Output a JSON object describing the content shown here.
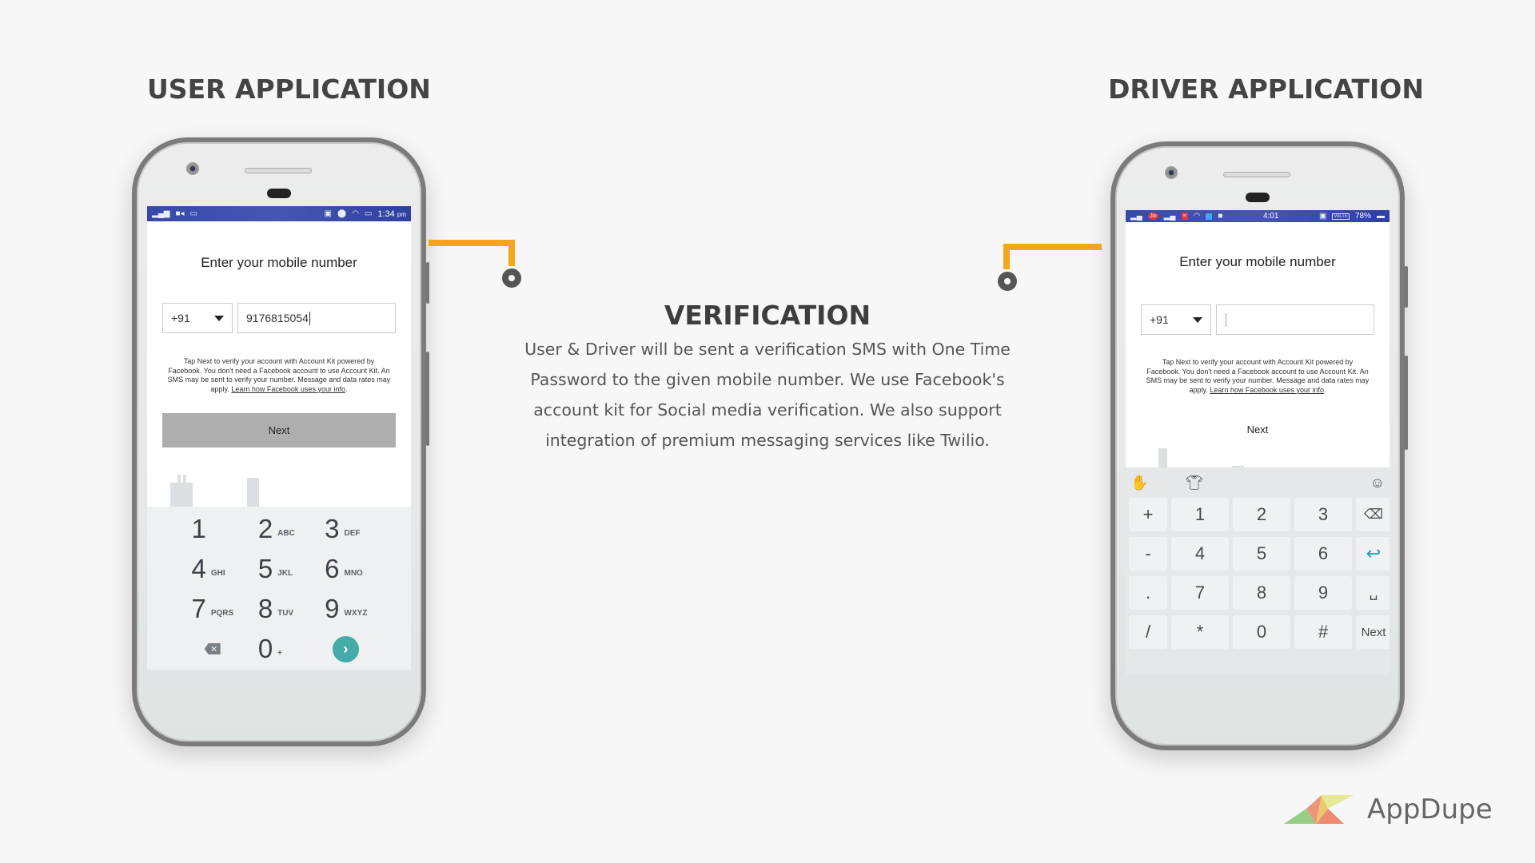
{
  "headings": {
    "user": "USER APPLICATION",
    "driver": "DRIVER APPLICATION"
  },
  "verification": {
    "title": "VERIFICATION",
    "body": "User & Driver will be sent a verification SMS with One Time Password to the given mobile number. We use Facebook's account kit for Social media verification. We also support integration of premium messaging services like Twilio."
  },
  "colors": {
    "connector": "#f2a816",
    "status_bar": "#3848a8",
    "go_button": "#45aaa8",
    "background": "#f7f7f7"
  },
  "user_app": {
    "status_bar": {
      "left_icons": [
        "signal-icon",
        "video-icon",
        "keyboard-icon"
      ],
      "right_icons": [
        "cast-icon",
        "location-icon",
        "wifi-icon",
        "battery-icon"
      ],
      "time": "1:34",
      "ampm": "pm"
    },
    "title": "Enter your mobile number",
    "country_code": "+91",
    "phone_value": "9176815054",
    "disclaimer": "Tap Next to verify your account with Account Kit powered by Facebook. You don't need a Facebook account to use Account Kit. An SMS may be sent to verify your number. Message and data rates may apply. ",
    "disclaimer_link": "Learn how Facebook uses your info",
    "next_label": "Next",
    "dialpad": [
      {
        "num": "1",
        "letters": ""
      },
      {
        "num": "2",
        "letters": "ABC"
      },
      {
        "num": "3",
        "letters": "DEF"
      },
      {
        "num": "4",
        "letters": "GHI"
      },
      {
        "num": "5",
        "letters": "JKL"
      },
      {
        "num": "6",
        "letters": "MNO"
      },
      {
        "num": "7",
        "letters": "PQRS"
      },
      {
        "num": "8",
        "letters": "TUV"
      },
      {
        "num": "9",
        "letters": "WXYZ"
      }
    ],
    "zero_key": {
      "num": "0",
      "letters": "+"
    },
    "backspace_glyph": "✕",
    "go_glyph": "›"
  },
  "driver_app": {
    "status_bar": {
      "left_icons": [
        "signal-icon",
        "jio-icon",
        "signal-icon",
        "notification-icon",
        "wifi-icon",
        "app-icon",
        "video-icon"
      ],
      "time": "4:01",
      "volte": "VoLTE",
      "battery": "78%"
    },
    "title": "Enter your mobile number",
    "country_code": "+91",
    "phone_value": "",
    "disclaimer": "Tap Next to verify your account with Account Kit powered by Facebook. You don't need a Facebook account to use Account Kit. An SMS may be sent to verify your number. Message and data rates may apply. ",
    "disclaimer_link": "Learn how Facebook uses your info",
    "next_label": "Next",
    "keyboard": {
      "rows": [
        [
          "+",
          "1",
          "2",
          "3",
          "⌫"
        ],
        [
          "-",
          "4",
          "5",
          "6",
          "↩"
        ],
        [
          ".",
          "7",
          "8",
          "9",
          "␣"
        ],
        [
          "/",
          "*",
          "0",
          "#",
          "Next"
        ]
      ]
    }
  },
  "logo": {
    "text": "AppDupe"
  }
}
